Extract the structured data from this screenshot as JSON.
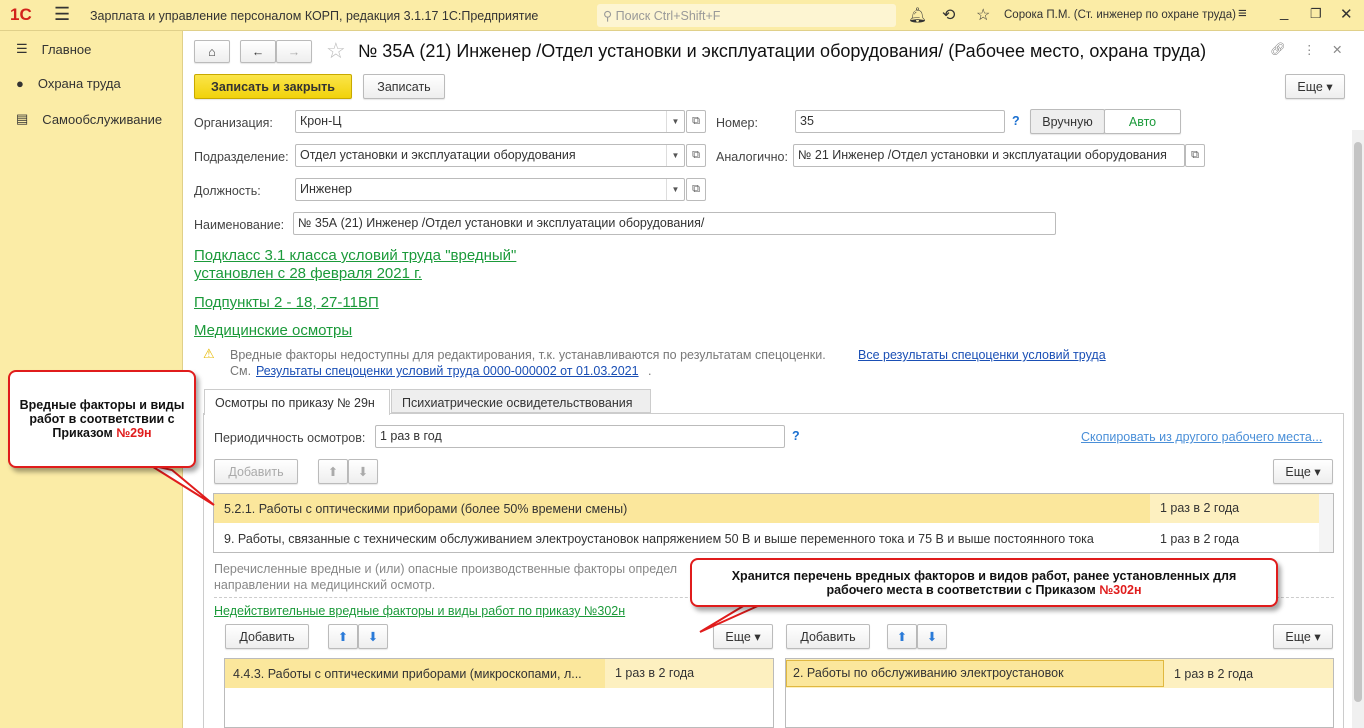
{
  "app": {
    "title": "Зарплата и управление персоналом КОРП, редакция 3.1.17 1С:Предприятие",
    "search_placeholder": "Поиск Ctrl+Shift+F",
    "user": "Сорока П.М. (Ст. инженер по охране труда)",
    "logo": "1С"
  },
  "sidebar": {
    "items": [
      {
        "label": "Главное"
      },
      {
        "label": "Охрана труда"
      },
      {
        "label": "Самообслуживание"
      }
    ]
  },
  "form": {
    "title": "№ 35А (21) Инженер /Отдел установки и эксплуатации оборудования/ (Рабочее место, охрана труда)",
    "save_close": "Записать и закрыть",
    "save": "Записать",
    "more": "Еще",
    "org_label": "Организация:",
    "org": "Крон-Ц",
    "num_label": "Номер:",
    "num": "35",
    "help": "?",
    "manual": "Вручную",
    "auto": "Авто",
    "dept_label": "Подразделение:",
    "dept": "Отдел установки и эксплуатации оборудования",
    "similar_label": "Аналогично:",
    "similar": "№ 21 Инженер /Отдел установки и эксплуатации оборудования",
    "pos_label": "Должность:",
    "pos": "Инженер",
    "name_label": "Наименование:",
    "name": "№ 35А (21) Инженер /Отдел установки и эксплуатации оборудования/",
    "subclass1": "Подкласс 3.1 класса условий труда \"вредный\"",
    "subclass2": "установлен с 28 февраля 2021 г.",
    "subitems": "Подпункты 2 - 18, 27-11ВП",
    "medical": "Медицинские осмотры",
    "warn": "Вредные факторы недоступны для редактирования, т.к. устанавливаются по результатам спецоценки.",
    "warn_link": "Все результаты спецоценки условий труда",
    "see": "См.",
    "see_link": "Результаты спецоценки условий труда 0000-000002 от 01.03.2021",
    "dot": "."
  },
  "tabs": [
    {
      "label": "Осмотры по приказу № 29н"
    },
    {
      "label": "Психиатрические освидетельствования"
    }
  ],
  "tab": {
    "period_label": "Периодичность осмотров:",
    "period": "1 раз в год",
    "copy_link": "Скопировать из другого рабочего места...",
    "add": "Добавить",
    "more": "Еще",
    "rows": [
      {
        "name": "5.2.1. Работы с оптическими приборами (более 50% времени смены)",
        "period": "1 раз в 2 года"
      },
      {
        "name": "9. Работы, связанные с техническим обслуживанием электроустановок напряжением 50 В и выше переменного тока и 75 В и выше постоянного тока",
        "period": "1 раз в 2 года"
      }
    ],
    "note1": "Перечисленные вредные и (или) опасные производственные факторы определ",
    "note2": "направлении на медицинский осмотр.",
    "invalid_link": "Недействительные вредные факторы и виды работ по приказу №302н",
    "left_row": {
      "name": "4.4.3. Работы с оптическими приборами (микроскопами, л...",
      "period": "1 раз в 2 года"
    },
    "right_row": {
      "name": "2. Работы по обслуживанию электроустановок",
      "period": "1 раз в 2 года"
    }
  },
  "callouts": {
    "c1_text": "Вредные факторы и виды работ в соответствии с Приказом ",
    "c1_red": "№29н",
    "c2_text": "Хранится перечень вредных факторов и видов работ, ранее установленных для рабочего места в соответствии с Приказом ",
    "c2_red": "№302н"
  }
}
